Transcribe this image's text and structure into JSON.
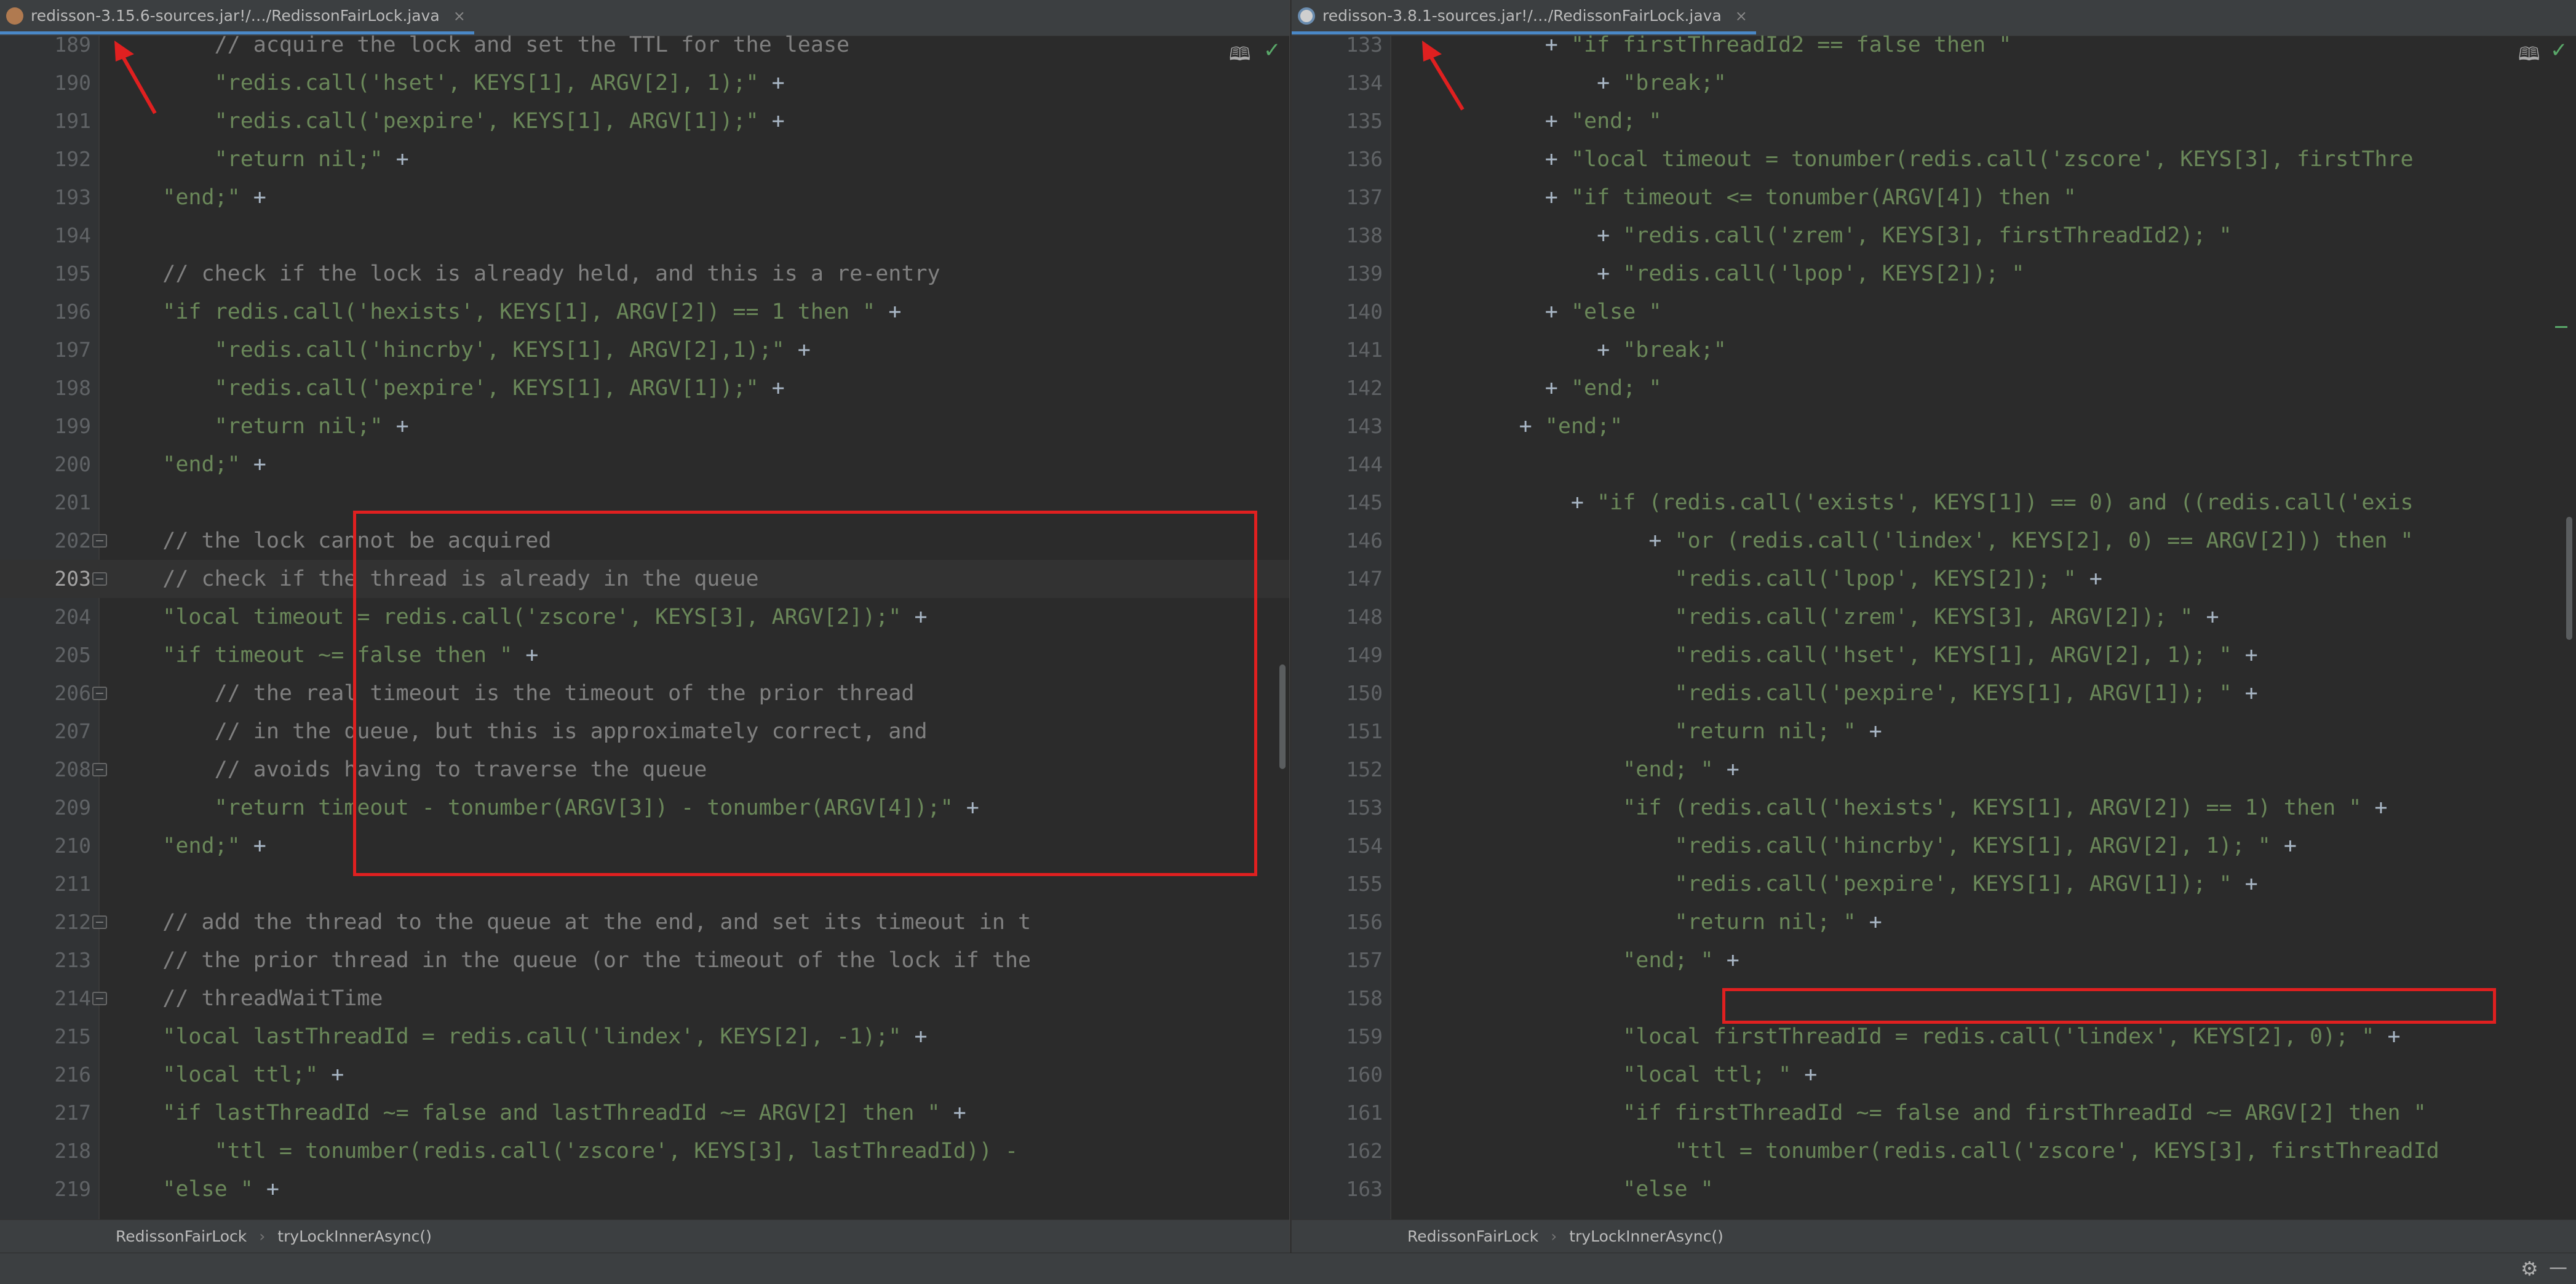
{
  "left": {
    "tab": "redisson-3.15.6-sources.jar!/…/RedissonFairLock.java",
    "breadcrumb": [
      "RedissonFairLock",
      "tryLockInnerAsync()"
    ],
    "lines": [
      {
        "n": "189",
        "t": [
          [
            "c",
            "        // acquire the lock and set the TTL for the lease"
          ]
        ]
      },
      {
        "n": "190",
        "t": [
          [
            "s",
            "        \"redis.call('hset', KEYS[1], ARGV[2], 1);\""
          ],
          [
            "o",
            " +"
          ]
        ]
      },
      {
        "n": "191",
        "t": [
          [
            "s",
            "        \"redis.call('pexpire', KEYS[1], ARGV[1]);\""
          ],
          [
            "o",
            " +"
          ]
        ]
      },
      {
        "n": "192",
        "t": [
          [
            "s",
            "        \"return nil;\""
          ],
          [
            "o",
            " +"
          ]
        ]
      },
      {
        "n": "193",
        "t": [
          [
            "s",
            "    \"end;\""
          ],
          [
            "o",
            " +"
          ]
        ]
      },
      {
        "n": "194",
        "t": []
      },
      {
        "n": "195",
        "t": [
          [
            "c",
            "    // check if the lock is already held, and this is a re-entry"
          ]
        ]
      },
      {
        "n": "196",
        "t": [
          [
            "s",
            "    \"if redis.call('hexists', KEYS[1], ARGV[2]) == 1 then \""
          ],
          [
            "o",
            " +"
          ]
        ]
      },
      {
        "n": "197",
        "t": [
          [
            "s",
            "        \"redis.call('hincrby', KEYS[1], ARGV[2],1);\""
          ],
          [
            "o",
            " +"
          ]
        ]
      },
      {
        "n": "198",
        "t": [
          [
            "s",
            "        \"redis.call('pexpire', KEYS[1], ARGV[1]);\""
          ],
          [
            "o",
            " +"
          ]
        ]
      },
      {
        "n": "199",
        "t": [
          [
            "s",
            "        \"return nil;\""
          ],
          [
            "o",
            " +"
          ]
        ]
      },
      {
        "n": "200",
        "t": [
          [
            "s",
            "    \"end;\""
          ],
          [
            "o",
            " +"
          ]
        ]
      },
      {
        "n": "201",
        "t": []
      },
      {
        "n": "202",
        "t": [
          [
            "c",
            "    // the lock cannot be acquired"
          ]
        ]
      },
      {
        "n": "203",
        "t": [
          [
            "c",
            "    // check if the thread is already in the queue"
          ]
        ]
      },
      {
        "n": "204",
        "t": [
          [
            "s",
            "    \"local timeout = redis.call('zscore', KEYS[3], ARGV[2]);\""
          ],
          [
            "o",
            " +"
          ]
        ]
      },
      {
        "n": "205",
        "t": [
          [
            "s",
            "    \"if timeout ~= false then \""
          ],
          [
            "o",
            " +"
          ]
        ]
      },
      {
        "n": "206",
        "t": [
          [
            "c",
            "        // the real timeout is the timeout of the prior thread"
          ]
        ]
      },
      {
        "n": "207",
        "t": [
          [
            "c",
            "        // in the queue, but this is approximately correct, and"
          ]
        ]
      },
      {
        "n": "208",
        "t": [
          [
            "c",
            "        // avoids having to traverse the queue"
          ]
        ]
      },
      {
        "n": "209",
        "t": [
          [
            "s",
            "        \"return timeout - tonumber(ARGV[3]) - tonumber(ARGV[4]);\""
          ],
          [
            "o",
            " +"
          ]
        ]
      },
      {
        "n": "210",
        "t": [
          [
            "s",
            "    \"end;\""
          ],
          [
            "o",
            " +"
          ]
        ]
      },
      {
        "n": "211",
        "t": []
      },
      {
        "n": "212",
        "t": [
          [
            "c",
            "    // add the thread to the queue at the end, and set its timeout in t"
          ]
        ]
      },
      {
        "n": "213",
        "t": [
          [
            "c",
            "    // the prior thread in the queue (or the timeout of the lock if the"
          ]
        ]
      },
      {
        "n": "214",
        "t": [
          [
            "c",
            "    // threadWaitTime"
          ]
        ]
      },
      {
        "n": "215",
        "t": [
          [
            "s",
            "    \"local lastThreadId = redis.call('lindex', KEYS[2], -1);\""
          ],
          [
            "o",
            " +"
          ]
        ]
      },
      {
        "n": "216",
        "t": [
          [
            "s",
            "    \"local ttl;\""
          ],
          [
            "o",
            " +"
          ]
        ]
      },
      {
        "n": "217",
        "t": [
          [
            "s",
            "    \"if lastThreadId ~= false and lastThreadId ~= ARGV[2] then \""
          ],
          [
            "o",
            " +"
          ]
        ]
      },
      {
        "n": "218",
        "t": [
          [
            "s",
            "        \"ttl = tonumber(redis.call('zscore', KEYS[3], lastThreadId)) -"
          ]
        ]
      },
      {
        "n": "219",
        "t": [
          [
            "s",
            "    \"else \""
          ],
          [
            "o",
            " +"
          ]
        ]
      }
    ]
  },
  "right": {
    "tab": "redisson-3.8.1-sources.jar!/…/RedissonFairLock.java",
    "breadcrumb": [
      "RedissonFairLock",
      "tryLockInnerAsync()"
    ],
    "lines": [
      {
        "n": "133",
        "t": [
          [
            "o",
            "           + "
          ],
          [
            "s",
            "\"if firstThreadId2 == false then \""
          ]
        ]
      },
      {
        "n": "134",
        "t": [
          [
            "o",
            "               + "
          ],
          [
            "s",
            "\"break;\""
          ]
        ]
      },
      {
        "n": "135",
        "t": [
          [
            "o",
            "           + "
          ],
          [
            "s",
            "\"end; \""
          ]
        ]
      },
      {
        "n": "136",
        "t": [
          [
            "o",
            "           + "
          ],
          [
            "s",
            "\"local timeout = tonumber(redis.call('zscore', KEYS[3], firstThre"
          ]
        ]
      },
      {
        "n": "137",
        "t": [
          [
            "o",
            "           + "
          ],
          [
            "s",
            "\"if timeout <= tonumber(ARGV[4]) then \""
          ]
        ]
      },
      {
        "n": "138",
        "t": [
          [
            "o",
            "               + "
          ],
          [
            "s",
            "\"redis.call('zrem', KEYS[3], firstThreadId2); \""
          ]
        ]
      },
      {
        "n": "139",
        "t": [
          [
            "o",
            "               + "
          ],
          [
            "s",
            "\"redis.call('lpop', KEYS[2]); \""
          ]
        ]
      },
      {
        "n": "140",
        "t": [
          [
            "o",
            "           + "
          ],
          [
            "s",
            "\"else \""
          ]
        ]
      },
      {
        "n": "141",
        "t": [
          [
            "o",
            "               + "
          ],
          [
            "s",
            "\"break;\""
          ]
        ]
      },
      {
        "n": "142",
        "t": [
          [
            "o",
            "           + "
          ],
          [
            "s",
            "\"end; \""
          ]
        ]
      },
      {
        "n": "143",
        "t": [
          [
            "o",
            "         + "
          ],
          [
            "s",
            "\"end;\""
          ]
        ]
      },
      {
        "n": "144",
        "t": []
      },
      {
        "n": "145",
        "t": [
          [
            "o",
            "             + "
          ],
          [
            "s",
            "\"if (redis.call('exists', KEYS[1]) == 0) and ((redis.call('exis"
          ]
        ]
      },
      {
        "n": "146",
        "t": [
          [
            "o",
            "                   + "
          ],
          [
            "s",
            "\"or (redis.call('lindex', KEYS[2], 0) == ARGV[2])) then \""
          ]
        ]
      },
      {
        "n": "147",
        "t": [
          [
            "s",
            "                     \"redis.call('lpop', KEYS[2]); \""
          ],
          [
            "o",
            " +"
          ]
        ]
      },
      {
        "n": "148",
        "t": [
          [
            "s",
            "                     \"redis.call('zrem', KEYS[3], ARGV[2]); \""
          ],
          [
            "o",
            " +"
          ]
        ]
      },
      {
        "n": "149",
        "t": [
          [
            "s",
            "                     \"redis.call('hset', KEYS[1], ARGV[2], 1); \""
          ],
          [
            "o",
            " +"
          ]
        ]
      },
      {
        "n": "150",
        "t": [
          [
            "s",
            "                     \"redis.call('pexpire', KEYS[1], ARGV[1]); \""
          ],
          [
            "o",
            " +"
          ]
        ]
      },
      {
        "n": "151",
        "t": [
          [
            "s",
            "                     \"return nil; \""
          ],
          [
            "o",
            " +"
          ]
        ]
      },
      {
        "n": "152",
        "t": [
          [
            "s",
            "                 \"end; \""
          ],
          [
            "o",
            " +"
          ]
        ]
      },
      {
        "n": "153",
        "t": [
          [
            "s",
            "                 \"if (redis.call('hexists', KEYS[1], ARGV[2]) == 1) then \""
          ],
          [
            "o",
            " +"
          ]
        ]
      },
      {
        "n": "154",
        "t": [
          [
            "s",
            "                     \"redis.call('hincrby', KEYS[1], ARGV[2], 1); \""
          ],
          [
            "o",
            " +"
          ]
        ]
      },
      {
        "n": "155",
        "t": [
          [
            "s",
            "                     \"redis.call('pexpire', KEYS[1], ARGV[1]); \""
          ],
          [
            "o",
            " +"
          ]
        ]
      },
      {
        "n": "156",
        "t": [
          [
            "s",
            "                     \"return nil; \""
          ],
          [
            "o",
            " +"
          ]
        ]
      },
      {
        "n": "157",
        "t": [
          [
            "s",
            "                 \"end; \""
          ],
          [
            "o",
            " +"
          ]
        ]
      },
      {
        "n": "158",
        "t": []
      },
      {
        "n": "159",
        "t": [
          [
            "s",
            "                 \"local firstThreadId = redis.call('lindex', KEYS[2], 0); \""
          ],
          [
            "o",
            " +"
          ]
        ]
      },
      {
        "n": "160",
        "t": [
          [
            "s",
            "                 \"local ttl; \""
          ],
          [
            "o",
            " +"
          ]
        ]
      },
      {
        "n": "161",
        "t": [
          [
            "s",
            "                 \"if firstThreadId ~= false and firstThreadId ~= ARGV[2] then \""
          ]
        ]
      },
      {
        "n": "162",
        "t": [
          [
            "s",
            "                     \"ttl = tonumber(redis.call('zscore', KEYS[3], firstThreadId"
          ]
        ]
      },
      {
        "n": "163",
        "t": [
          [
            "s",
            "                 \"else \""
          ]
        ]
      }
    ]
  },
  "icons": {
    "reader_mode": "reader-mode-icon",
    "inspection_ok": "check-icon",
    "settings": "gear-icon"
  },
  "colors": {
    "background": "#2b2b2b",
    "string": "#6a8759",
    "comment": "#808080",
    "highlight_box": "#e02020"
  }
}
